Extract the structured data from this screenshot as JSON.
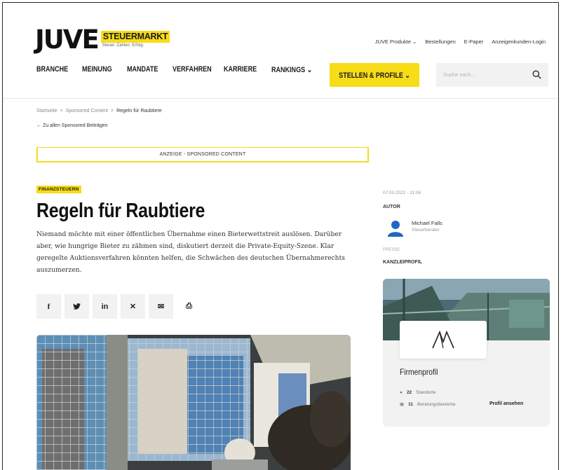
{
  "header": {
    "logo_main": "JUVE",
    "logo_tag": "STEUERMARKT",
    "logo_sub": "Steuer. Zahlen. Erfolg.",
    "top_links": [
      "JUVE Produkte ⌄",
      "Bestellungen",
      "E-Paper",
      "Anzeigenkunden-Login"
    ],
    "nav": [
      "BRANCHE",
      "MEINUNG",
      "MANDATE",
      "VERFAHREN",
      "KARRIERE",
      "RANKINGS ⌄"
    ],
    "cta_label": "STELLEN & PROFILE ⌄",
    "search_placeholder": "Suche nach...",
    "accent_color": "#f7dc18"
  },
  "breadcrumb": {
    "items": [
      "Startseite",
      "Sponsored Content",
      "Regeln für Raubtiere"
    ],
    "separator": ">"
  },
  "back_link": "← Zu allen Sponsored Beiträgen",
  "ad_banner": "ANZEIGE - SPONSORED CONTENT",
  "article": {
    "category": "FINANZSTEUERN",
    "title": "Regeln für Raubtiere",
    "lead": "Niemand möchte mit einer öffentlichen Übernahme einen Bieterwettstreit auslösen. Darüber aber, wie hungrige Bieter zu zähmen sind, diskutiert derzeit die Private-Equity-Szene. Klar geregelte Auktionsverfahren könnten helfen, die Schwächen des deutschen Übernahmerechts auszumerzen.",
    "share_icons": [
      "f",
      "▼",
      "in",
      "✕",
      "✉",
      "⎙"
    ]
  },
  "sidebar": {
    "date": "07.03.2022 - 11:06",
    "author_label": "AUTOR",
    "author_name": "Michael Falls",
    "author_role": "Steuerberater",
    "presse_label": "PRESSE",
    "kanzlei_label": "KANZLEIPROFIL",
    "card": {
      "title": "Firmenprofil",
      "stat1_value": "22",
      "stat1_label": "Standorte",
      "stat2_value": "11",
      "stat2_label": "Beratungsbereiche",
      "link": "Profil ansehen"
    }
  }
}
